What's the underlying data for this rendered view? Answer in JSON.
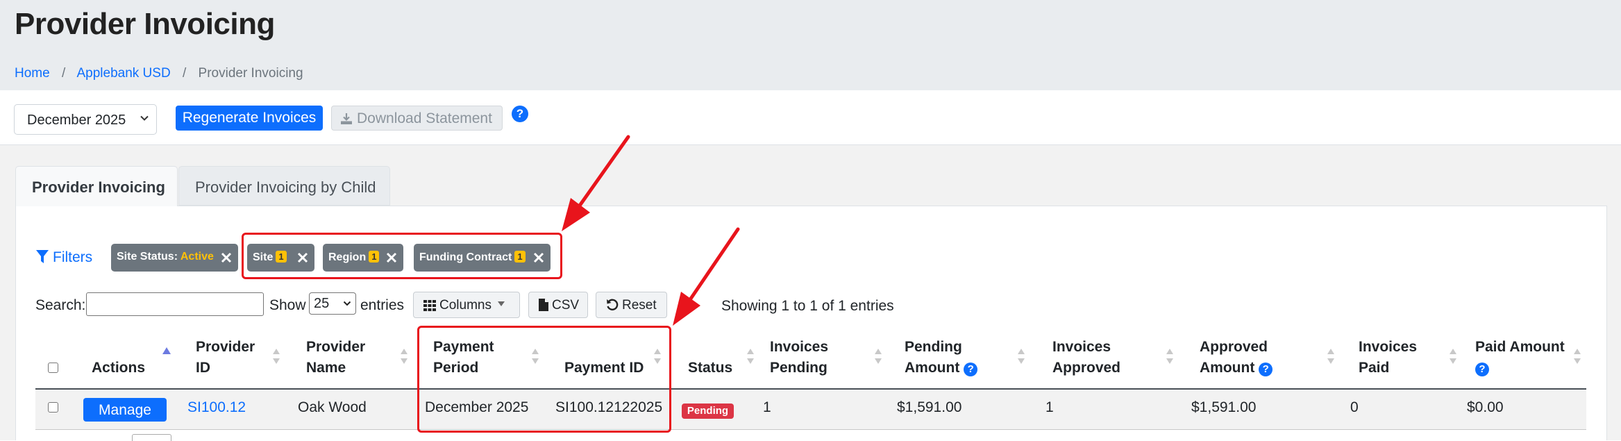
{
  "page": {
    "title": "Provider Invoicing"
  },
  "breadcrumb": {
    "home": "Home",
    "org": "Applebank USD",
    "current": "Provider Invoicing",
    "separator": "/"
  },
  "toolbar": {
    "month_value": "December 2025",
    "regenerate_label": "Regenerate Invoices",
    "download_label": "Download Statement",
    "help": "?"
  },
  "tabs": [
    {
      "label": "Provider Invoicing",
      "active": true
    },
    {
      "label": "Provider Invoicing by Child",
      "active": false
    }
  ],
  "filters": {
    "link_label": "Filters",
    "chips": [
      {
        "label": "Site Status:",
        "value": "Active"
      },
      {
        "label": "Site",
        "count": "1"
      },
      {
        "label": "Region",
        "count": "1"
      },
      {
        "label": "Funding Contract",
        "count": "1"
      }
    ]
  },
  "controls": {
    "search_label": "Search:",
    "search_value": "",
    "show_label": "Show",
    "page_length": "25",
    "entries_label": "entries",
    "columns_label": "Columns",
    "csv_label": "CSV",
    "reset_label": "Reset",
    "info": "Showing 1 to 1 of 1 entries"
  },
  "table": {
    "columns": {
      "actions": "Actions",
      "provider_id": [
        "Provider",
        "ID"
      ],
      "provider_name": [
        "Provider",
        "Name"
      ],
      "payment_period": [
        "Payment",
        "Period"
      ],
      "payment_id": "Payment ID",
      "status": "Status",
      "invoices_pending": [
        "Invoices",
        "Pending"
      ],
      "pending_amount": [
        "Pending",
        "Amount"
      ],
      "invoices_approved": [
        "Invoices",
        "Approved"
      ],
      "approved_amount": [
        "Approved",
        "Amount"
      ],
      "invoices_paid": [
        "Invoices",
        "Paid"
      ],
      "paid_amount": "Paid Amount"
    },
    "rows": [
      {
        "action": "Manage",
        "provider_id": "SI100.12",
        "provider_name": "Oak Wood",
        "payment_period": "December 2025",
        "payment_id": "SI100.12122025",
        "status": "Pending",
        "invoices_pending": "1",
        "pending_amount": "$1,591.00",
        "invoices_approved": "1",
        "approved_amount": "$1,591.00",
        "invoices_paid": "0",
        "paid_amount": "$0.00"
      }
    ]
  },
  "colors": {
    "primary": "#0d6efd",
    "annotation": "#e8141c",
    "chip": "#6c757d",
    "chip_highlight": "#ffc107",
    "danger": "#dc3545"
  }
}
